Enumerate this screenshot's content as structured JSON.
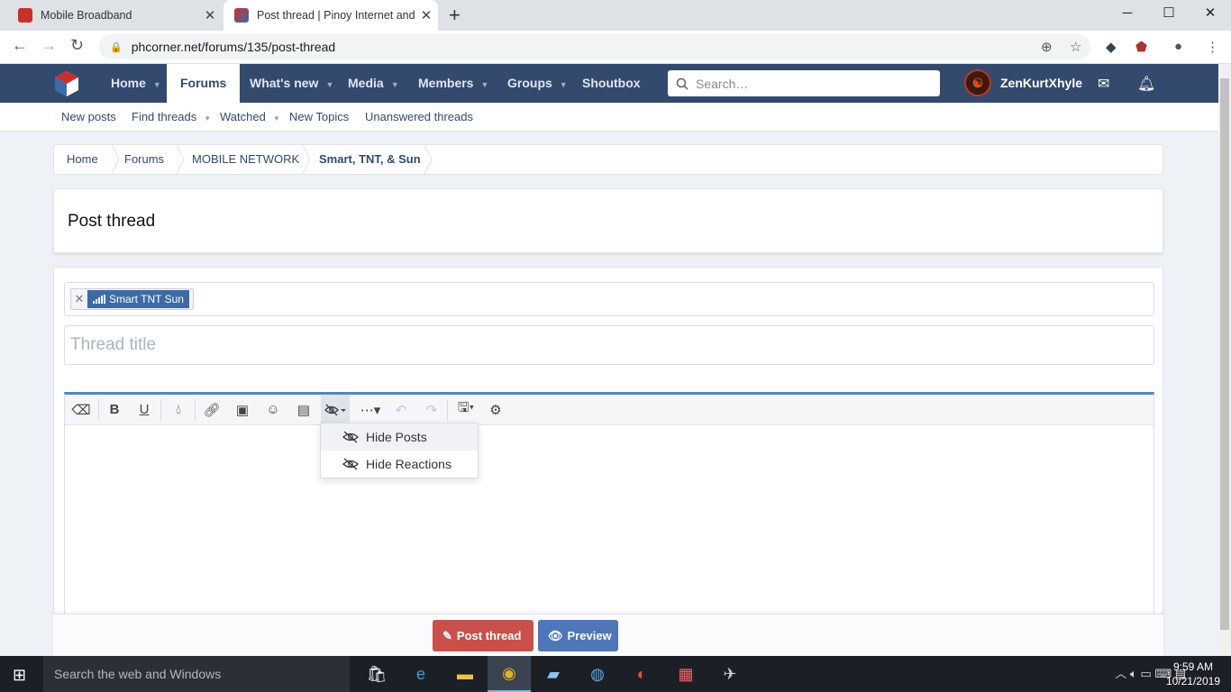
{
  "browser": {
    "tabs": [
      {
        "title": "Mobile Broadband"
      },
      {
        "title": "Post thread | Pinoy Internet and T"
      }
    ],
    "url": "phcorner.net/forums/135/post-thread"
  },
  "site": {
    "nav": [
      "Home",
      "Forums",
      "What's new",
      "Media",
      "Members",
      "Groups",
      "Shoutbox"
    ],
    "search_placeholder": "Search…",
    "username": "ZenKurtXhyle",
    "subnav": [
      "New posts",
      "Find threads",
      "Watched",
      "New Topics",
      "Unanswered threads"
    ]
  },
  "breadcrumbs": [
    "Home",
    "Forums",
    "MOBILE NETWORK",
    "Smart, TNT, & Sun"
  ],
  "page": {
    "title": "Post thread",
    "prefix_label": "Smart TNT Sun",
    "title_placeholder": "Thread title"
  },
  "editor": {
    "dropdown_items": [
      "Hide Posts",
      "Hide Reactions"
    ]
  },
  "buttons": {
    "post": "Post thread",
    "preview": "Preview"
  },
  "taskbar": {
    "search": "Search the web and Windows",
    "time": "9:59 AM",
    "date": "10/21/2019"
  },
  "colors": {
    "nav_bg": "#34496e",
    "post_button": "#c9504b",
    "preview_button": "#4f76b8",
    "editor_accent": "#4f86c8"
  }
}
